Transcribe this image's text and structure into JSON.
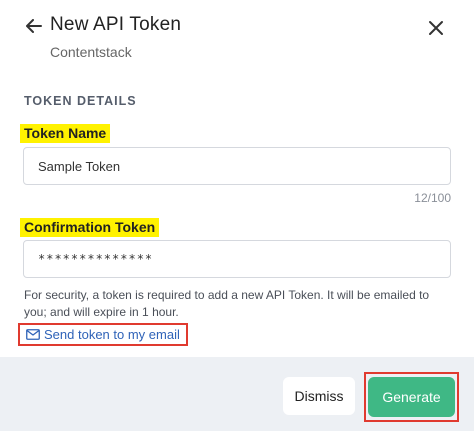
{
  "header": {
    "title": "New API Token",
    "subtitle": "Contentstack",
    "back_icon": "arrow-left-icon",
    "close_icon": "close-icon"
  },
  "section": {
    "label": "TOKEN DETAILS"
  },
  "token_name": {
    "label": "Token Name",
    "value": "Sample Token",
    "char_count": "12/100"
  },
  "confirmation_token": {
    "label": "Confirmation Token",
    "value": "**************"
  },
  "help_text": "For security, a token is required to add a new API Token. It will be emailed to you; and will expire in 1 hour.",
  "send_link": {
    "label": "Send token to my email",
    "icon": "mail-icon"
  },
  "footer": {
    "dismiss_label": "Dismiss",
    "generate_label": "Generate"
  },
  "colors": {
    "highlight": "#fff200",
    "annotation_border": "#e03a2f",
    "primary": "#3fb885",
    "link": "#2f63b8",
    "footer_bg": "#edf0f4"
  }
}
